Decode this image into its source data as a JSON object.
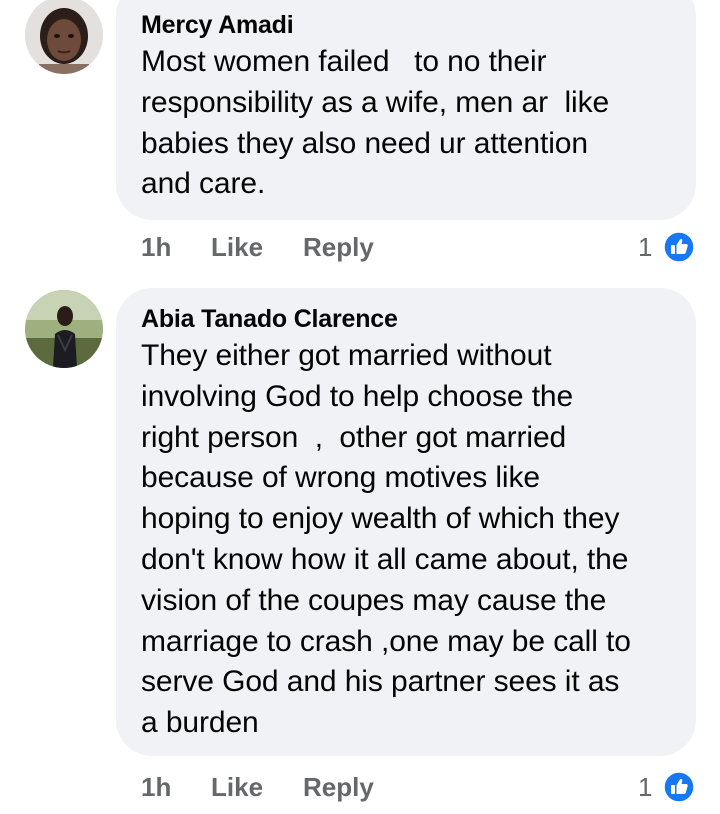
{
  "comments": [
    {
      "author": "Mercy Amadi",
      "text": "Most women failed   to no their\nresponsibility as a wife, men ar  like\nbabies they also need ur attention\nand care.",
      "time": "1h",
      "like_label": "Like",
      "reply_label": "Reply",
      "reaction_count": "1",
      "reaction_icon": "like-reaction-icon",
      "avatar_icon": "avatar-mercy-amadi"
    },
    {
      "author": "Abia Tanado Clarence",
      "text": "They either got married without\ninvolving God to help choose the\nright person  ,  other got married\nbecause of wrong motives like\nhoping to enjoy wealth of which they\ndon't know how it all came about, the\nvision of the coupes may cause the\nmarriage to crash ,one may be call to\nserve God and his partner sees it as\na burden",
      "time": "1h",
      "like_label": "Like",
      "reply_label": "Reply",
      "reaction_count": "1",
      "reaction_icon": "like-reaction-icon",
      "avatar_icon": "avatar-abia-tanado-clarence"
    }
  ],
  "colors": {
    "bubble": "#f0f2f5",
    "meta_text": "#65676b",
    "like_blue": "#1877f2"
  }
}
